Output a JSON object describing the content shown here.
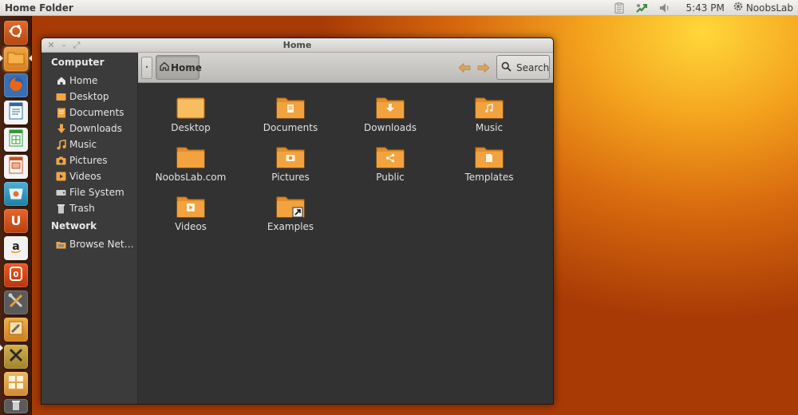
{
  "panel": {
    "app_title": "Home Folder",
    "clock": "5:43 PM",
    "user": "NoobsLab",
    "indicators": [
      "clipboard-icon",
      "network-icon",
      "volume-icon"
    ]
  },
  "launcher": {
    "items": [
      {
        "name": "dash-home-button",
        "icon": "ubuntu-logo-icon",
        "color": "#c8531c"
      },
      {
        "name": "files-launcher",
        "icon": "folder-icon",
        "color": "#e88b2a"
      },
      {
        "name": "firefox-launcher",
        "icon": "firefox-icon",
        "color": "#d85a1a"
      },
      {
        "name": "libreoffice-writer-launcher",
        "icon": "document-icon",
        "color": "#2a6ca8"
      },
      {
        "name": "libreoffice-calc-launcher",
        "icon": "spreadsheet-icon",
        "color": "#2f9a3a"
      },
      {
        "name": "libreoffice-impress-launcher",
        "icon": "presentation-icon",
        "color": "#c9501f"
      },
      {
        "name": "software-center-launcher",
        "icon": "software-center-icon",
        "color": "#2f8fb5"
      },
      {
        "name": "ubuntu-one-launcher",
        "icon": "ubuntu-one-icon",
        "color": "#d24a15"
      },
      {
        "name": "amazon-launcher",
        "icon": "amazon-icon",
        "color": "#f1f1f1"
      },
      {
        "name": "ubuntu-one-music-launcher",
        "icon": "ubuntu-one-alt-icon",
        "color": "#d5431a"
      },
      {
        "name": "system-settings-launcher",
        "icon": "tools-icon",
        "color": "#6a6a6a"
      },
      {
        "name": "gnome-tweak-launcher",
        "icon": "wrench-icon",
        "color": "#e39a2c"
      },
      {
        "name": "settings-alt-launcher",
        "icon": "tools-alt-icon",
        "color": "#c8a23a"
      },
      {
        "name": "workspace-switcher-launcher",
        "icon": "workspaces-icon",
        "color": "#e6a24a"
      },
      {
        "name": "trash-launcher",
        "icon": "trash-icon",
        "color": "#5b5b5b"
      }
    ]
  },
  "window": {
    "title": "Home",
    "breadcrumb": {
      "current": "Home"
    },
    "search_label": "Search"
  },
  "sidebar": {
    "computer_heading": "Computer",
    "items": [
      {
        "label": "Home",
        "icon": "home-icon"
      },
      {
        "label": "Desktop",
        "icon": "desktop-icon"
      },
      {
        "label": "Documents",
        "icon": "documents-icon"
      },
      {
        "label": "Downloads",
        "icon": "downloads-icon"
      },
      {
        "label": "Music",
        "icon": "music-icon"
      },
      {
        "label": "Pictures",
        "icon": "pictures-icon"
      },
      {
        "label": "Videos",
        "icon": "videos-icon"
      },
      {
        "label": "File System",
        "icon": "drive-icon"
      },
      {
        "label": "Trash",
        "icon": "trash-icon"
      }
    ],
    "network_heading": "Network",
    "network_items": [
      {
        "label": "Browse Net…",
        "icon": "network-folder-icon"
      }
    ]
  },
  "files": [
    {
      "label": "Desktop",
      "emblem": "none"
    },
    {
      "label": "Documents",
      "emblem": "document"
    },
    {
      "label": "Downloads",
      "emblem": "download"
    },
    {
      "label": "Music",
      "emblem": "music"
    },
    {
      "label": "NoobsLab.com",
      "emblem": "none"
    },
    {
      "label": "Pictures",
      "emblem": "camera"
    },
    {
      "label": "Public",
      "emblem": "share"
    },
    {
      "label": "Templates",
      "emblem": "template"
    },
    {
      "label": "Videos",
      "emblem": "video"
    },
    {
      "label": "Examples",
      "emblem": "symlink"
    }
  ],
  "colors": {
    "folder_orange": "#f29a2e",
    "window_dark": "#323232",
    "sidebar_dark": "#3b3b3b",
    "launcher_bg": "#4b2310"
  }
}
